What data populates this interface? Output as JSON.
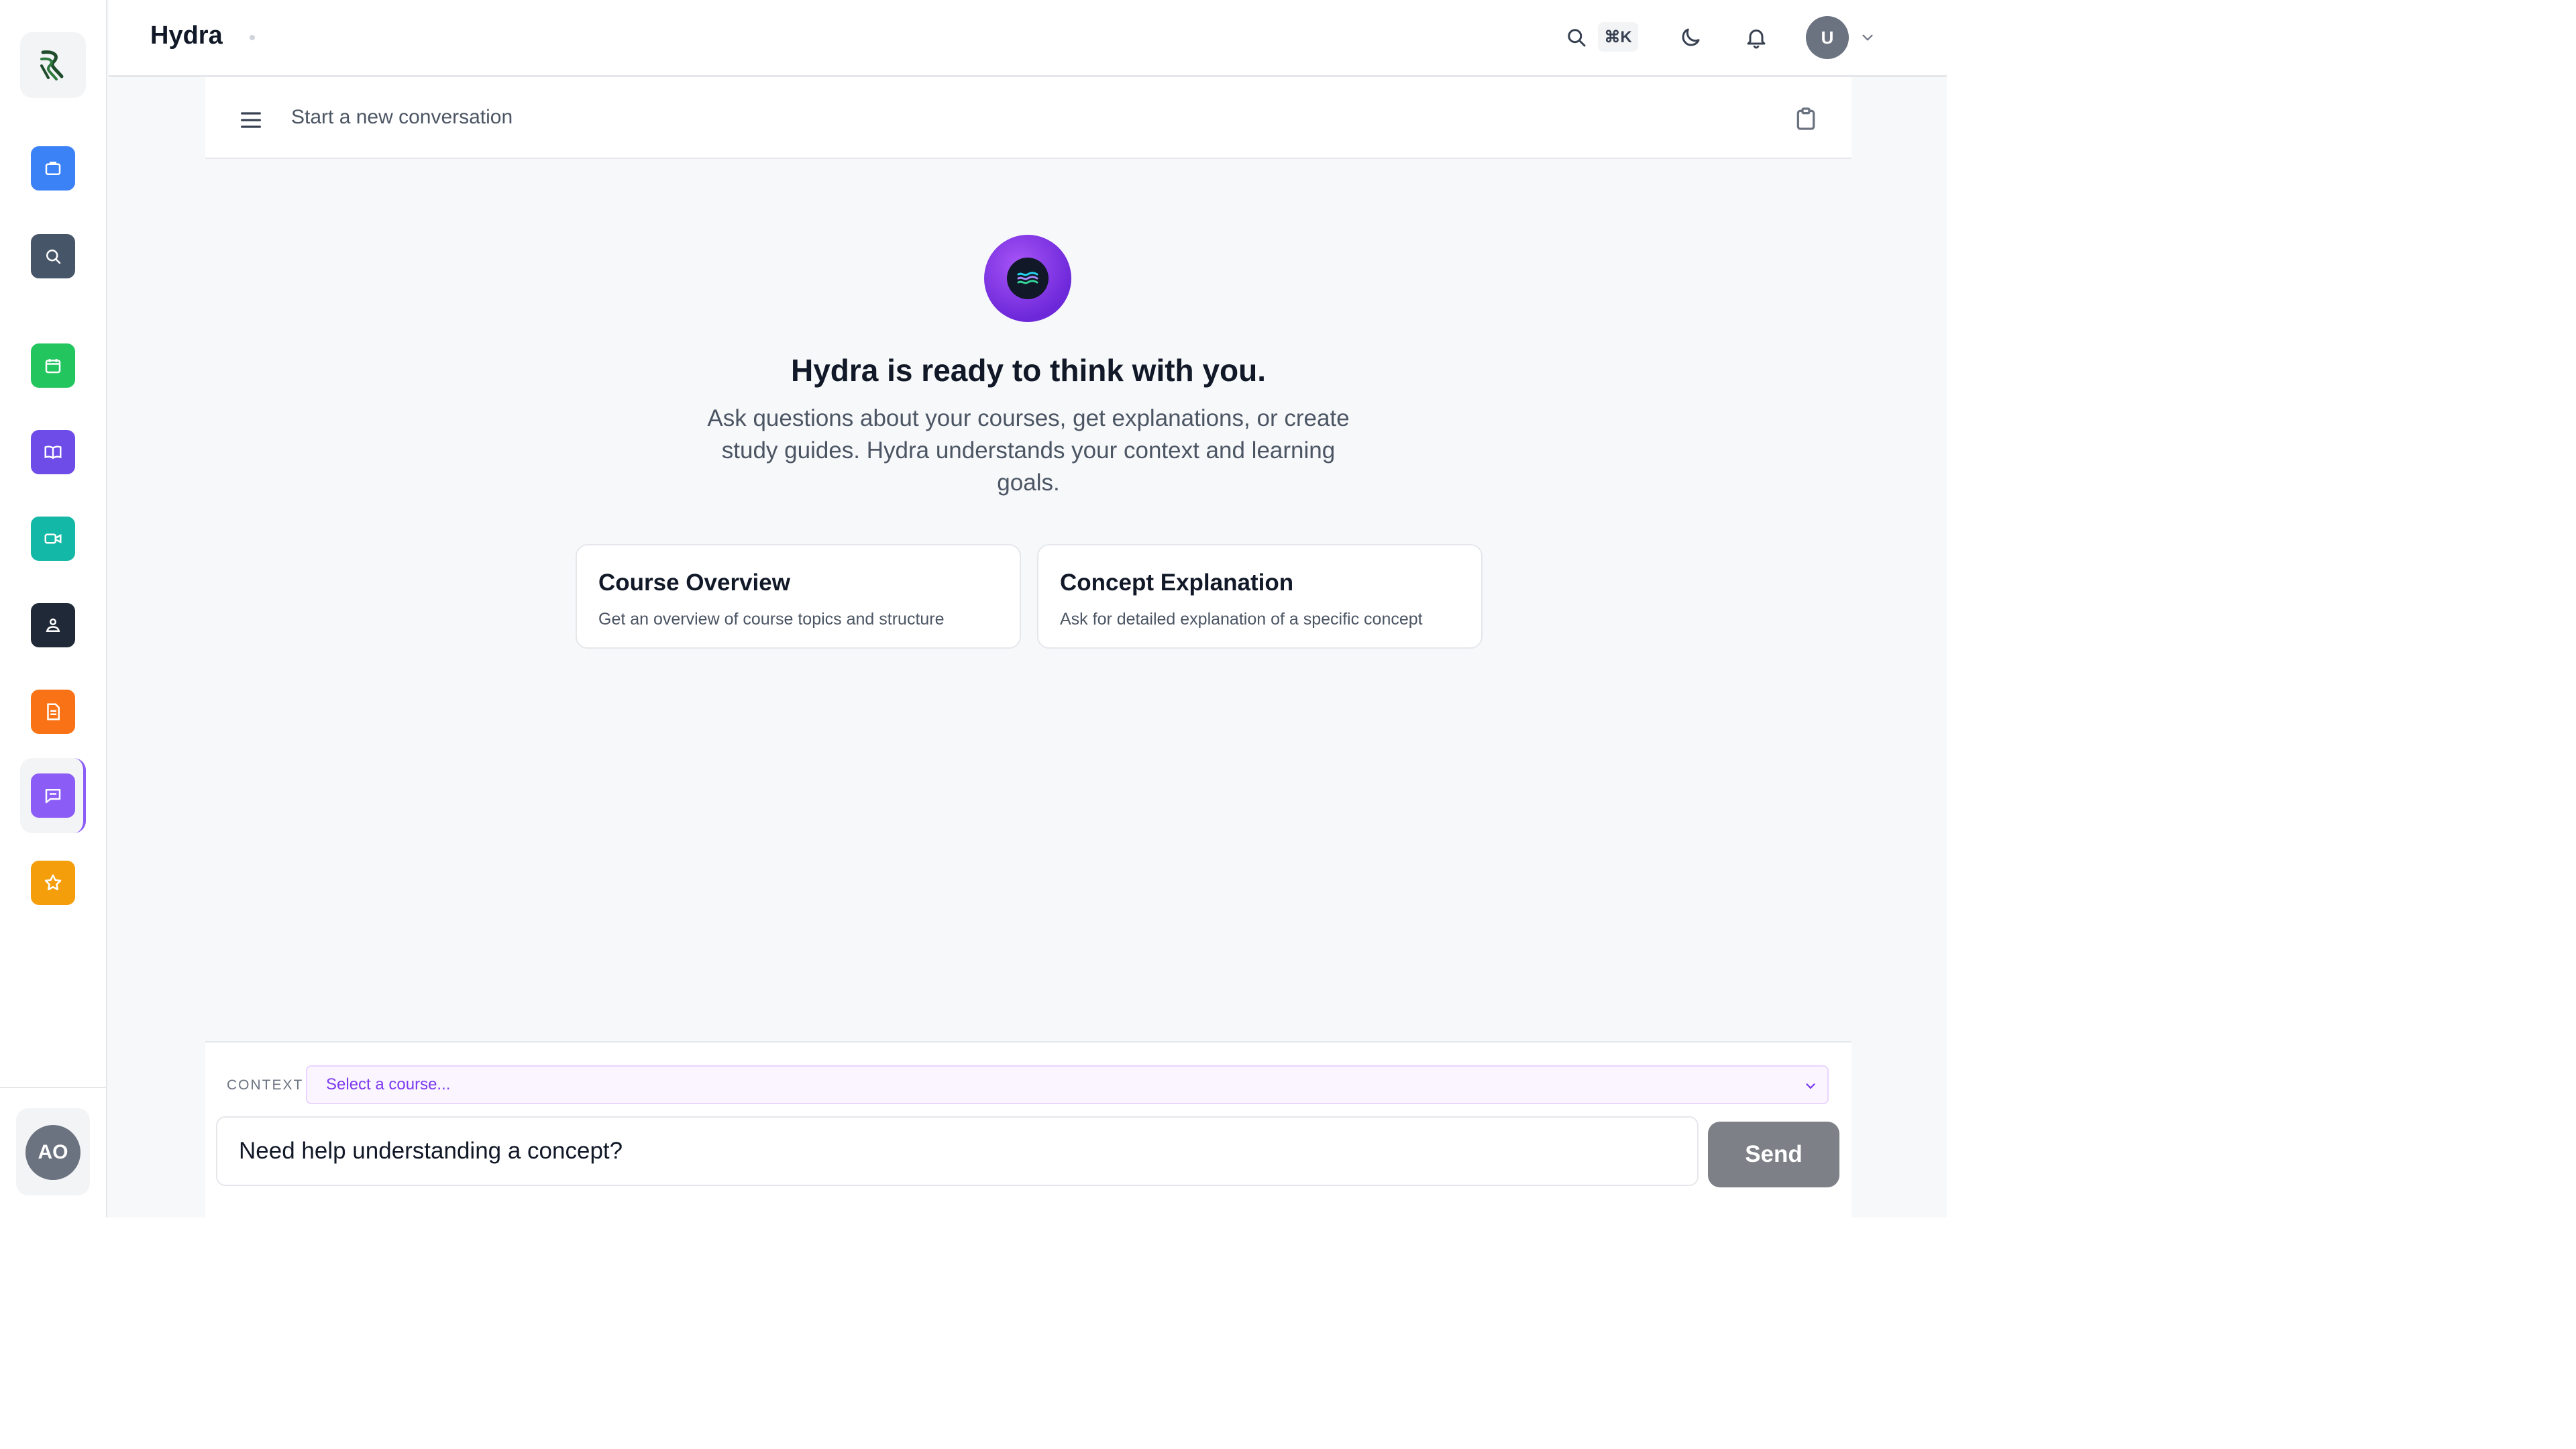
{
  "app": {
    "title": "Hydra"
  },
  "header": {
    "shortcut": "⌘K",
    "user_initial": "U",
    "icons": [
      "search-icon",
      "moon-icon",
      "bell-icon",
      "chevron-down-icon"
    ]
  },
  "sidebar": {
    "items": [
      {
        "name": "briefcase-icon",
        "color": "#3b82f6"
      },
      {
        "name": "search-icon",
        "color": "#475569"
      },
      {
        "name": "calendar-icon",
        "color": "#22c55e"
      },
      {
        "name": "book-icon",
        "color": "#6d4ce8"
      },
      {
        "name": "video-icon",
        "color": "#14b8a6"
      },
      {
        "name": "graduation-icon",
        "color": "#1f2937"
      },
      {
        "name": "document-icon",
        "color": "#f97316"
      },
      {
        "name": "chat-icon",
        "color": "#8b5cf6",
        "active": true
      },
      {
        "name": "star-icon",
        "color": "#f59e0b"
      }
    ],
    "user_initials": "AO"
  },
  "chat": {
    "topbar_title": "Start a new conversation",
    "hero_title": "Hydra is ready to think with you.",
    "hero_subtitle": "Ask questions about your courses, get explanations, or create study guides. Hydra understands your context and learning goals.",
    "cards": [
      {
        "title": "Course Overview",
        "description": "Get an overview of course topics and structure"
      },
      {
        "title": "Concept Explanation",
        "description": "Ask for detailed explanation of a specific concept"
      }
    ],
    "context_label": "CONTEXT",
    "context_select": "Select a course...",
    "input_value": "Need help understanding a concept?",
    "send_label": "Send"
  }
}
